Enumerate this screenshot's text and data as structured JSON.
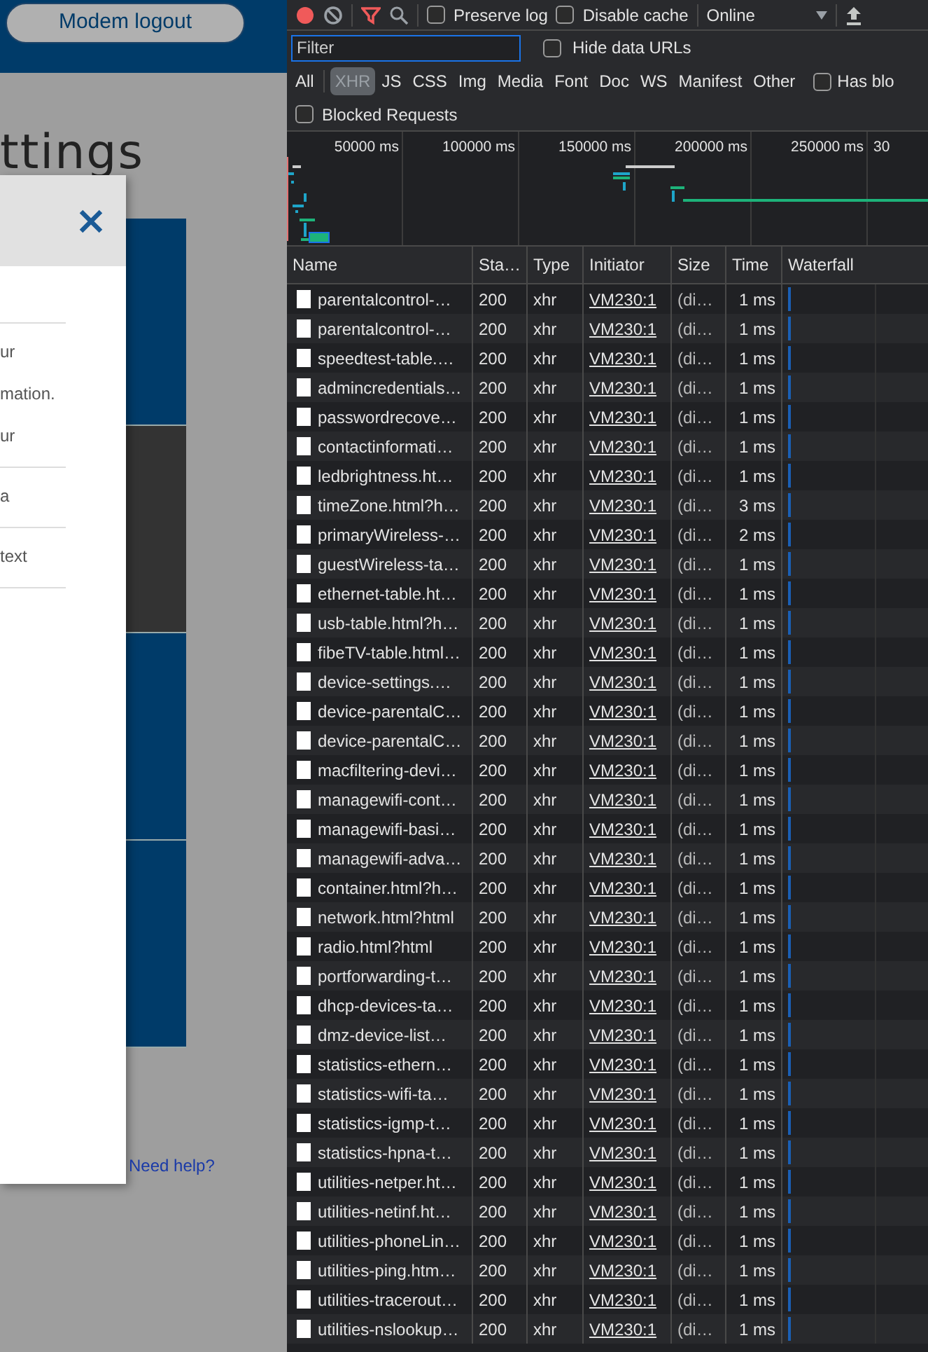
{
  "page": {
    "logout_button": "Modem logout",
    "heading": "ttings",
    "panels": [
      {
        "color": "#003b69"
      },
      {
        "color": "#333333"
      },
      {
        "color": "#003b69"
      },
      {
        "color": "#003b69"
      }
    ],
    "modal": {
      "items": [
        {
          "kind": "divider"
        },
        {
          "kind": "text",
          "text": "ur"
        },
        {
          "kind": "text",
          "text": "mation."
        },
        {
          "kind": "text",
          "text": "ur"
        },
        {
          "kind": "divider"
        },
        {
          "kind": "text",
          "text": "a"
        },
        {
          "kind": "divider"
        },
        {
          "kind": "text",
          "text": "text"
        },
        {
          "kind": "divider"
        }
      ]
    },
    "help_link": "Need help?"
  },
  "devtools": {
    "toolbar": {
      "recording": true,
      "filter_active": true,
      "checkboxes": [
        {
          "label": "Preserve log",
          "checked": false
        },
        {
          "label": "Disable cache",
          "checked": false
        }
      ],
      "throttling": "Online"
    },
    "filter": {
      "placeholder": "Filter",
      "hide_data_urls": {
        "label": "Hide data URLs",
        "checked": false
      }
    },
    "types": [
      {
        "label": "All",
        "selected": false
      },
      {
        "label": "XHR",
        "selected": true
      },
      {
        "label": "JS",
        "selected": false
      },
      {
        "label": "CSS",
        "selected": false
      },
      {
        "label": "Img",
        "selected": false
      },
      {
        "label": "Media",
        "selected": false
      },
      {
        "label": "Font",
        "selected": false
      },
      {
        "label": "Doc",
        "selected": false
      },
      {
        "label": "WS",
        "selected": false
      },
      {
        "label": "Manifest",
        "selected": false
      },
      {
        "label": "Other",
        "selected": false
      }
    ],
    "has_blocked": {
      "label": "Has blo",
      "checked": false
    },
    "blocked_requests": {
      "label": "Blocked Requests",
      "checked": false
    },
    "overview_ticks": [
      "50000 ms",
      "100000 ms",
      "150000 ms",
      "200000 ms",
      "250000 ms",
      "30"
    ],
    "table": {
      "columns": [
        "Name",
        "Sta…",
        "Type",
        "Initiator",
        "Size",
        "Time",
        "Waterfall"
      ],
      "rows": [
        {
          "name": "parentalcontrol-…",
          "status": "200",
          "type": "xhr",
          "initiator": "VM230:1",
          "size": "(di…",
          "time": "1 ms"
        },
        {
          "name": "parentalcontrol-…",
          "status": "200",
          "type": "xhr",
          "initiator": "VM230:1",
          "size": "(di…",
          "time": "1 ms"
        },
        {
          "name": "speedtest-table.…",
          "status": "200",
          "type": "xhr",
          "initiator": "VM230:1",
          "size": "(di…",
          "time": "1 ms"
        },
        {
          "name": "admincredentials…",
          "status": "200",
          "type": "xhr",
          "initiator": "VM230:1",
          "size": "(di…",
          "time": "1 ms"
        },
        {
          "name": "passwordrecove…",
          "status": "200",
          "type": "xhr",
          "initiator": "VM230:1",
          "size": "(di…",
          "time": "1 ms"
        },
        {
          "name": "contactinformati…",
          "status": "200",
          "type": "xhr",
          "initiator": "VM230:1",
          "size": "(di…",
          "time": "1 ms"
        },
        {
          "name": "ledbrightness.ht…",
          "status": "200",
          "type": "xhr",
          "initiator": "VM230:1",
          "size": "(di…",
          "time": "1 ms"
        },
        {
          "name": "timeZone.html?h…",
          "status": "200",
          "type": "xhr",
          "initiator": "VM230:1",
          "size": "(di…",
          "time": "3 ms"
        },
        {
          "name": "primaryWireless-…",
          "status": "200",
          "type": "xhr",
          "initiator": "VM230:1",
          "size": "(di…",
          "time": "2 ms"
        },
        {
          "name": "guestWireless-ta…",
          "status": "200",
          "type": "xhr",
          "initiator": "VM230:1",
          "size": "(di…",
          "time": "1 ms"
        },
        {
          "name": "ethernet-table.ht…",
          "status": "200",
          "type": "xhr",
          "initiator": "VM230:1",
          "size": "(di…",
          "time": "1 ms"
        },
        {
          "name": "usb-table.html?h…",
          "status": "200",
          "type": "xhr",
          "initiator": "VM230:1",
          "size": "(di…",
          "time": "1 ms"
        },
        {
          "name": "fibeTV-table.html…",
          "status": "200",
          "type": "xhr",
          "initiator": "VM230:1",
          "size": "(di…",
          "time": "1 ms"
        },
        {
          "name": "device-settings.…",
          "status": "200",
          "type": "xhr",
          "initiator": "VM230:1",
          "size": "(di…",
          "time": "1 ms"
        },
        {
          "name": "device-parentalC…",
          "status": "200",
          "type": "xhr",
          "initiator": "VM230:1",
          "size": "(di…",
          "time": "1 ms"
        },
        {
          "name": "device-parentalC…",
          "status": "200",
          "type": "xhr",
          "initiator": "VM230:1",
          "size": "(di…",
          "time": "1 ms"
        },
        {
          "name": "macfiltering-devi…",
          "status": "200",
          "type": "xhr",
          "initiator": "VM230:1",
          "size": "(di…",
          "time": "1 ms"
        },
        {
          "name": "managewifi-cont…",
          "status": "200",
          "type": "xhr",
          "initiator": "VM230:1",
          "size": "(di…",
          "time": "1 ms"
        },
        {
          "name": "managewifi-basi…",
          "status": "200",
          "type": "xhr",
          "initiator": "VM230:1",
          "size": "(di…",
          "time": "1 ms"
        },
        {
          "name": "managewifi-adva…",
          "status": "200",
          "type": "xhr",
          "initiator": "VM230:1",
          "size": "(di…",
          "time": "1 ms"
        },
        {
          "name": "container.html?h…",
          "status": "200",
          "type": "xhr",
          "initiator": "VM230:1",
          "size": "(di…",
          "time": "1 ms"
        },
        {
          "name": "network.html?html",
          "status": "200",
          "type": "xhr",
          "initiator": "VM230:1",
          "size": "(di…",
          "time": "1 ms"
        },
        {
          "name": "radio.html?html",
          "status": "200",
          "type": "xhr",
          "initiator": "VM230:1",
          "size": "(di…",
          "time": "1 ms"
        },
        {
          "name": "portforwarding-t…",
          "status": "200",
          "type": "xhr",
          "initiator": "VM230:1",
          "size": "(di…",
          "time": "1 ms"
        },
        {
          "name": "dhcp-devices-ta…",
          "status": "200",
          "type": "xhr",
          "initiator": "VM230:1",
          "size": "(di…",
          "time": "1 ms"
        },
        {
          "name": "dmz-device-list…",
          "status": "200",
          "type": "xhr",
          "initiator": "VM230:1",
          "size": "(di…",
          "time": "1 ms"
        },
        {
          "name": "statistics-ethern…",
          "status": "200",
          "type": "xhr",
          "initiator": "VM230:1",
          "size": "(di…",
          "time": "1 ms"
        },
        {
          "name": "statistics-wifi-ta…",
          "status": "200",
          "type": "xhr",
          "initiator": "VM230:1",
          "size": "(di…",
          "time": "1 ms"
        },
        {
          "name": "statistics-igmp-t…",
          "status": "200",
          "type": "xhr",
          "initiator": "VM230:1",
          "size": "(di…",
          "time": "1 ms"
        },
        {
          "name": "statistics-hpna-t…",
          "status": "200",
          "type": "xhr",
          "initiator": "VM230:1",
          "size": "(di…",
          "time": "1 ms"
        },
        {
          "name": "utilities-netper.ht…",
          "status": "200",
          "type": "xhr",
          "initiator": "VM230:1",
          "size": "(di…",
          "time": "1 ms"
        },
        {
          "name": "utilities-netinf.ht…",
          "status": "200",
          "type": "xhr",
          "initiator": "VM230:1",
          "size": "(di…",
          "time": "1 ms"
        },
        {
          "name": "utilities-phoneLin…",
          "status": "200",
          "type": "xhr",
          "initiator": "VM230:1",
          "size": "(di…",
          "time": "1 ms"
        },
        {
          "name": "utilities-ping.htm…",
          "status": "200",
          "type": "xhr",
          "initiator": "VM230:1",
          "size": "(di…",
          "time": "1 ms"
        },
        {
          "name": "utilities-tracerout…",
          "status": "200",
          "type": "xhr",
          "initiator": "VM230:1",
          "size": "(di…",
          "time": "1 ms"
        },
        {
          "name": "utilities-nslookup…",
          "status": "200",
          "type": "xhr",
          "initiator": "VM230:1",
          "size": "(di…",
          "time": "1 ms"
        }
      ]
    }
  }
}
